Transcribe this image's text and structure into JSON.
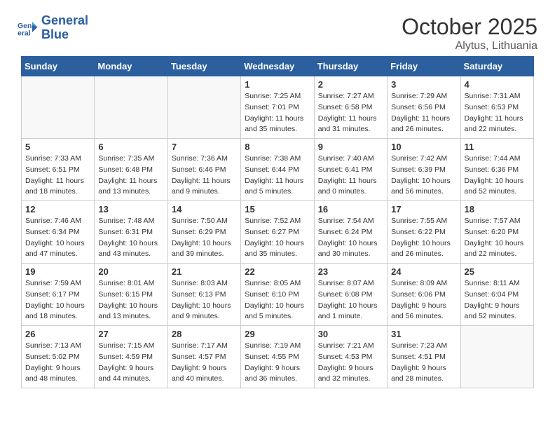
{
  "header": {
    "logo_line1": "General",
    "logo_line2": "Blue",
    "month": "October 2025",
    "location": "Alytus, Lithuania"
  },
  "weekdays": [
    "Sunday",
    "Monday",
    "Tuesday",
    "Wednesday",
    "Thursday",
    "Friday",
    "Saturday"
  ],
  "weeks": [
    [
      {
        "day": "",
        "info": ""
      },
      {
        "day": "",
        "info": ""
      },
      {
        "day": "",
        "info": ""
      },
      {
        "day": "1",
        "info": "Sunrise: 7:25 AM\nSunset: 7:01 PM\nDaylight: 11 hours\nand 35 minutes."
      },
      {
        "day": "2",
        "info": "Sunrise: 7:27 AM\nSunset: 6:58 PM\nDaylight: 11 hours\nand 31 minutes."
      },
      {
        "day": "3",
        "info": "Sunrise: 7:29 AM\nSunset: 6:56 PM\nDaylight: 11 hours\nand 26 minutes."
      },
      {
        "day": "4",
        "info": "Sunrise: 7:31 AM\nSunset: 6:53 PM\nDaylight: 11 hours\nand 22 minutes."
      }
    ],
    [
      {
        "day": "5",
        "info": "Sunrise: 7:33 AM\nSunset: 6:51 PM\nDaylight: 11 hours\nand 18 minutes."
      },
      {
        "day": "6",
        "info": "Sunrise: 7:35 AM\nSunset: 6:48 PM\nDaylight: 11 hours\nand 13 minutes."
      },
      {
        "day": "7",
        "info": "Sunrise: 7:36 AM\nSunset: 6:46 PM\nDaylight: 11 hours\nand 9 minutes."
      },
      {
        "day": "8",
        "info": "Sunrise: 7:38 AM\nSunset: 6:44 PM\nDaylight: 11 hours\nand 5 minutes."
      },
      {
        "day": "9",
        "info": "Sunrise: 7:40 AM\nSunset: 6:41 PM\nDaylight: 11 hours\nand 0 minutes."
      },
      {
        "day": "10",
        "info": "Sunrise: 7:42 AM\nSunset: 6:39 PM\nDaylight: 10 hours\nand 56 minutes."
      },
      {
        "day": "11",
        "info": "Sunrise: 7:44 AM\nSunset: 6:36 PM\nDaylight: 10 hours\nand 52 minutes."
      }
    ],
    [
      {
        "day": "12",
        "info": "Sunrise: 7:46 AM\nSunset: 6:34 PM\nDaylight: 10 hours\nand 47 minutes."
      },
      {
        "day": "13",
        "info": "Sunrise: 7:48 AM\nSunset: 6:31 PM\nDaylight: 10 hours\nand 43 minutes."
      },
      {
        "day": "14",
        "info": "Sunrise: 7:50 AM\nSunset: 6:29 PM\nDaylight: 10 hours\nand 39 minutes."
      },
      {
        "day": "15",
        "info": "Sunrise: 7:52 AM\nSunset: 6:27 PM\nDaylight: 10 hours\nand 35 minutes."
      },
      {
        "day": "16",
        "info": "Sunrise: 7:54 AM\nSunset: 6:24 PM\nDaylight: 10 hours\nand 30 minutes."
      },
      {
        "day": "17",
        "info": "Sunrise: 7:55 AM\nSunset: 6:22 PM\nDaylight: 10 hours\nand 26 minutes."
      },
      {
        "day": "18",
        "info": "Sunrise: 7:57 AM\nSunset: 6:20 PM\nDaylight: 10 hours\nand 22 minutes."
      }
    ],
    [
      {
        "day": "19",
        "info": "Sunrise: 7:59 AM\nSunset: 6:17 PM\nDaylight: 10 hours\nand 18 minutes."
      },
      {
        "day": "20",
        "info": "Sunrise: 8:01 AM\nSunset: 6:15 PM\nDaylight: 10 hours\nand 13 minutes."
      },
      {
        "day": "21",
        "info": "Sunrise: 8:03 AM\nSunset: 6:13 PM\nDaylight: 10 hours\nand 9 minutes."
      },
      {
        "day": "22",
        "info": "Sunrise: 8:05 AM\nSunset: 6:10 PM\nDaylight: 10 hours\nand 5 minutes."
      },
      {
        "day": "23",
        "info": "Sunrise: 8:07 AM\nSunset: 6:08 PM\nDaylight: 10 hours\nand 1 minute."
      },
      {
        "day": "24",
        "info": "Sunrise: 8:09 AM\nSunset: 6:06 PM\nDaylight: 9 hours\nand 56 minutes."
      },
      {
        "day": "25",
        "info": "Sunrise: 8:11 AM\nSunset: 6:04 PM\nDaylight: 9 hours\nand 52 minutes."
      }
    ],
    [
      {
        "day": "26",
        "info": "Sunrise: 7:13 AM\nSunset: 5:02 PM\nDaylight: 9 hours\nand 48 minutes."
      },
      {
        "day": "27",
        "info": "Sunrise: 7:15 AM\nSunset: 4:59 PM\nDaylight: 9 hours\nand 44 minutes."
      },
      {
        "day": "28",
        "info": "Sunrise: 7:17 AM\nSunset: 4:57 PM\nDaylight: 9 hours\nand 40 minutes."
      },
      {
        "day": "29",
        "info": "Sunrise: 7:19 AM\nSunset: 4:55 PM\nDaylight: 9 hours\nand 36 minutes."
      },
      {
        "day": "30",
        "info": "Sunrise: 7:21 AM\nSunset: 4:53 PM\nDaylight: 9 hours\nand 32 minutes."
      },
      {
        "day": "31",
        "info": "Sunrise: 7:23 AM\nSunset: 4:51 PM\nDaylight: 9 hours\nand 28 minutes."
      },
      {
        "day": "",
        "info": ""
      }
    ]
  ]
}
